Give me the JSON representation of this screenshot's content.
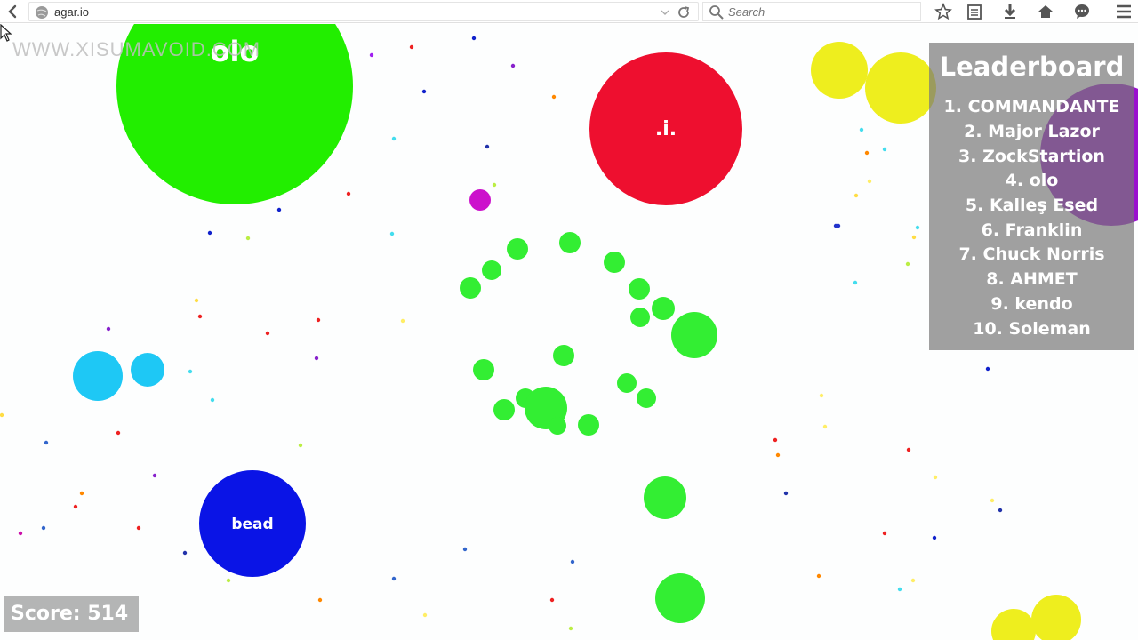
{
  "browser": {
    "url": "agar.io",
    "search_placeholder": "Search",
    "icons": [
      "back-icon",
      "globe-icon",
      "dropdown-icon",
      "reload-icon",
      "search-icon",
      "star-icon",
      "reading-list-icon",
      "download-icon",
      "home-icon",
      "chat-icon",
      "menu-icon"
    ]
  },
  "game": {
    "watermark": "WWW.XISUMAVOID.COM",
    "cells": {
      "olo": {
        "name": "olo",
        "color": "#22ee00"
      },
      "red": {
        "name": ".i.",
        "color": "#ee0f2f"
      },
      "bead": {
        "name": "bead",
        "color": "#0a14e6"
      }
    },
    "colors": {
      "player": "#33ee33",
      "cyan": "#1ec8f5",
      "yellow": "#eeee1e",
      "purple": "#9a0fcf",
      "magenta": "#cc11cc"
    },
    "leaderboard": {
      "title": "Leaderboard",
      "entries": [
        "1. COMMANDANTE",
        "2. Major Lazor",
        "3. ZockStartion",
        "4. olo",
        "5. Kalleş Esed",
        "6. Franklin",
        "7. Chuck Norris",
        "8. AHMET",
        "9. kendo",
        "10. Soleman"
      ]
    },
    "score": "Score: 514"
  }
}
